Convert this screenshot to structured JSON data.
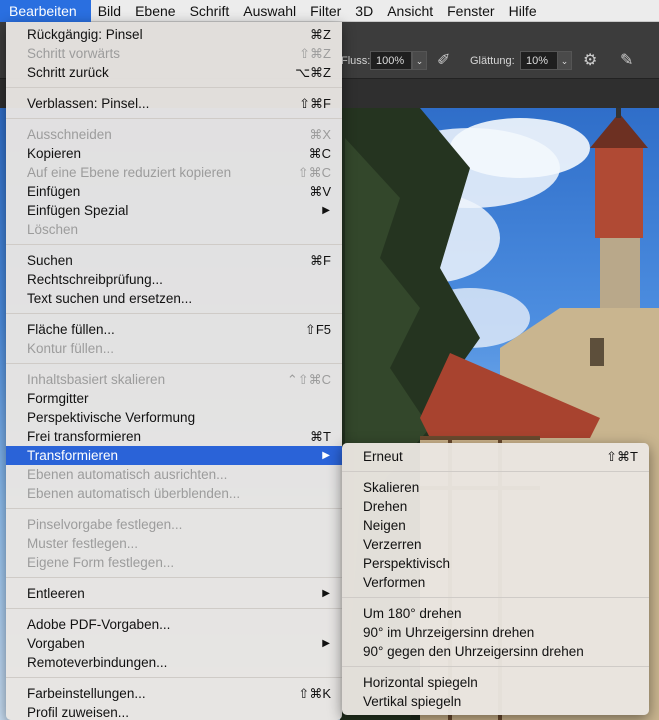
{
  "menubar": {
    "items": [
      "Bearbeiten",
      "Bild",
      "Ebene",
      "Schrift",
      "Auswahl",
      "Filter",
      "3D",
      "Ansicht",
      "Fenster",
      "Hilfe"
    ]
  },
  "options": {
    "fluss_label": "Fluss:",
    "fluss_value": "100%",
    "glaettung_label": "Glättung:",
    "glaettung_value": "10%"
  },
  "edit_menu": {
    "undo": {
      "label": "Rückgängig: Pinsel",
      "shortcut": "⌘Z"
    },
    "step_forward": {
      "label": "Schritt vorwärts",
      "shortcut": "⇧⌘Z"
    },
    "step_back": {
      "label": "Schritt zurück",
      "shortcut": "⌥⌘Z"
    },
    "fade": {
      "label": "Verblassen: Pinsel...",
      "shortcut": "⇧⌘F"
    },
    "cut": {
      "label": "Ausschneiden",
      "shortcut": "⌘X"
    },
    "copy": {
      "label": "Kopieren",
      "shortcut": "⌘C"
    },
    "copy_merged": {
      "label": "Auf eine Ebene reduziert kopieren",
      "shortcut": "⇧⌘C"
    },
    "paste": {
      "label": "Einfügen",
      "shortcut": "⌘V"
    },
    "paste_special": {
      "label": "Einfügen Spezial"
    },
    "clear": {
      "label": "Löschen"
    },
    "search": {
      "label": "Suchen",
      "shortcut": "⌘F"
    },
    "spellcheck": {
      "label": "Rechtschreibprüfung..."
    },
    "find_replace": {
      "label": "Text suchen und ersetzen..."
    },
    "fill": {
      "label": "Fläche füllen...",
      "shortcut": "⇧F5"
    },
    "stroke": {
      "label": "Kontur füllen..."
    },
    "content_aware_scale": {
      "label": "Inhaltsbasiert skalieren",
      "shortcut": "⌃⇧⌘C"
    },
    "puppet_warp": {
      "label": "Formgitter"
    },
    "perspective_warp": {
      "label": "Perspektivische Verformung"
    },
    "free_transform": {
      "label": "Frei transformieren",
      "shortcut": "⌘T"
    },
    "transform": {
      "label": "Transformieren"
    },
    "auto_align": {
      "label": "Ebenen automatisch ausrichten..."
    },
    "auto_blend": {
      "label": "Ebenen automatisch überblenden..."
    },
    "define_brush": {
      "label": "Pinselvorgabe festlegen..."
    },
    "define_pattern": {
      "label": "Muster festlegen..."
    },
    "define_shape": {
      "label": "Eigene Form festlegen..."
    },
    "purge": {
      "label": "Entleeren"
    },
    "pdf_presets": {
      "label": "Adobe PDF-Vorgaben..."
    },
    "presets": {
      "label": "Vorgaben"
    },
    "remote": {
      "label": "Remoteverbindungen..."
    },
    "color_settings": {
      "label": "Farbeinstellungen...",
      "shortcut": "⇧⌘K"
    },
    "assign_profile": {
      "label": "Profil zuweisen..."
    }
  },
  "transform_menu": {
    "again": {
      "label": "Erneut",
      "shortcut": "⇧⌘T"
    },
    "scale": "Skalieren",
    "rotate": "Drehen",
    "skew": "Neigen",
    "distort": "Verzerren",
    "perspective": "Perspektivisch",
    "warp": "Verformen",
    "rotate180": "Um 180° drehen",
    "rotate90cw": "90° im Uhrzeigersinn drehen",
    "rotate90ccw": "90° gegen den Uhrzeigersinn drehen",
    "flip_h": "Horizontal spiegeln",
    "flip_v": "Vertikal spiegeln"
  },
  "colors": {
    "accent": "#2a63d8",
    "menubar_active": "#2a6fe0"
  }
}
